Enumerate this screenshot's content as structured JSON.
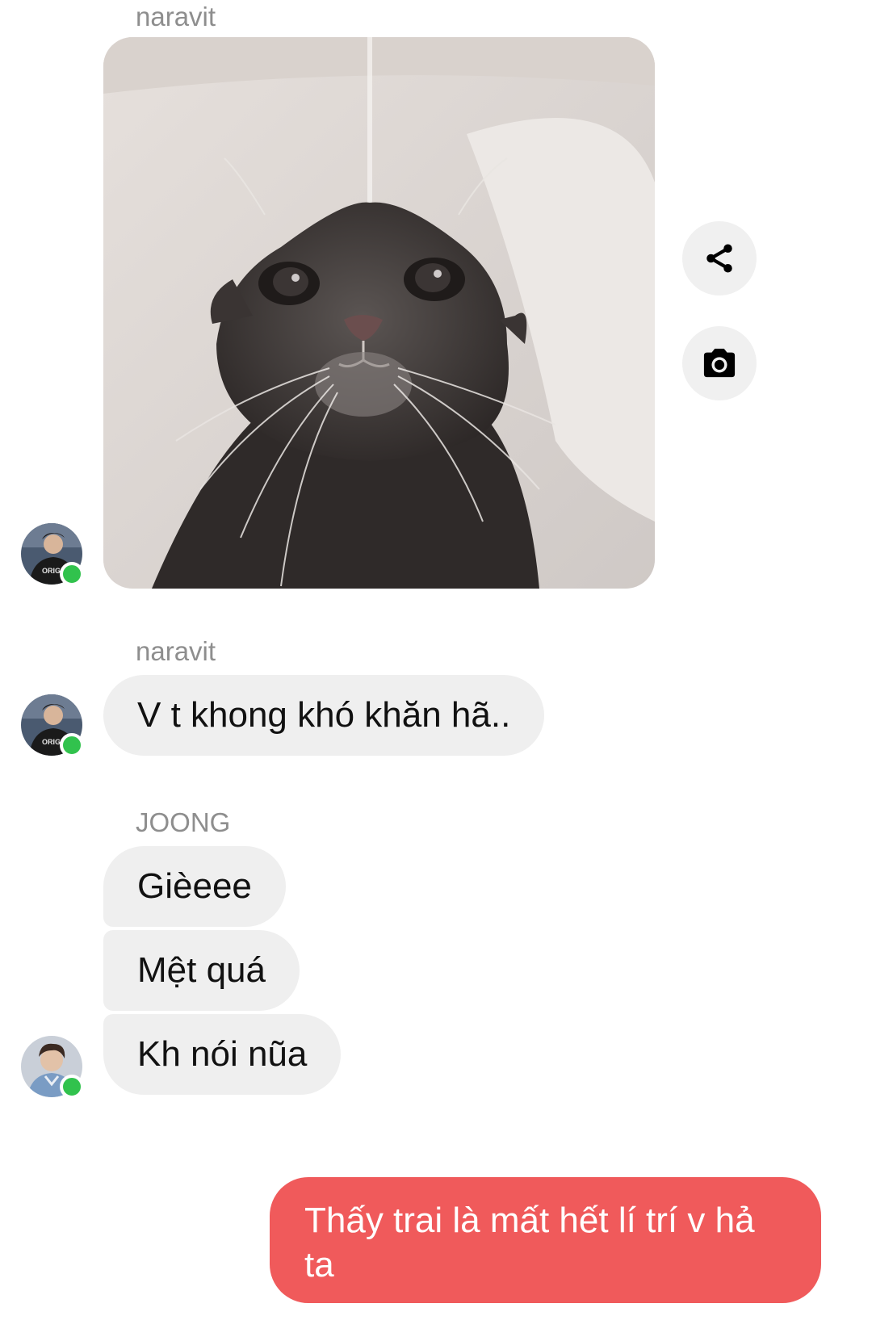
{
  "chat": {
    "messages": [
      {
        "sender": "naravit",
        "kind": "photo",
        "photo_subject": "wet cat under faucet"
      },
      {
        "sender": "naravit",
        "kind": "text",
        "text": "V t khong khó khăn hã.."
      },
      {
        "sender": "JOONG",
        "kind": "text-group",
        "texts": [
          "Gièeee",
          "Mệt quá",
          "Kh nói nũa"
        ]
      },
      {
        "sender": "me",
        "kind": "text",
        "text": "Thấy trai là mất hết lí trí v hả ta"
      }
    ],
    "actions": {
      "share_icon": "share-icon",
      "camera_icon": "camera-icon"
    }
  },
  "colors": {
    "incoming_bubble": "#efefef",
    "outgoing_bubble": "#f05a5b",
    "online": "#31c24d",
    "sender_name": "#8e8e8e"
  }
}
